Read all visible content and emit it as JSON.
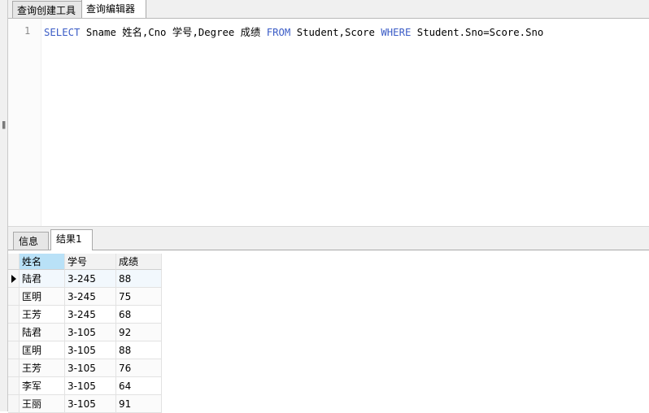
{
  "tabs": [
    {
      "label": "查询创建工具",
      "active": false
    },
    {
      "label": "查询编辑器",
      "active": true
    }
  ],
  "editor": {
    "line_number": "1",
    "tokens": [
      {
        "text": "SELECT",
        "keyword": true
      },
      {
        "text": " Sname 姓名,Cno 学号,Degree 成绩 ",
        "keyword": false
      },
      {
        "text": "FROM",
        "keyword": true
      },
      {
        "text": " Student,Score ",
        "keyword": false
      },
      {
        "text": "WHERE",
        "keyword": true
      },
      {
        "text": " Student.Sno=Score.Sno",
        "keyword": false
      }
    ],
    "keyword_color": "#3b5cc6"
  },
  "result_tabs": [
    {
      "label": "信息",
      "active": false
    },
    {
      "label": "结果1",
      "active": true
    }
  ],
  "grid": {
    "columns": [
      "姓名",
      "学号",
      "成绩"
    ],
    "rows": [
      [
        "陆君",
        "3-245",
        "88"
      ],
      [
        "匡明",
        "3-245",
        "75"
      ],
      [
        "王芳",
        "3-245",
        "68"
      ],
      [
        "陆君",
        "3-105",
        "92"
      ],
      [
        "匡明",
        "3-105",
        "88"
      ],
      [
        "王芳",
        "3-105",
        "76"
      ],
      [
        "李军",
        "3-105",
        "64"
      ],
      [
        "王丽",
        "3-105",
        "91"
      ]
    ],
    "header_highlight_color": "#b9e1f7",
    "current_row_marker": "row-pointer-icon"
  }
}
